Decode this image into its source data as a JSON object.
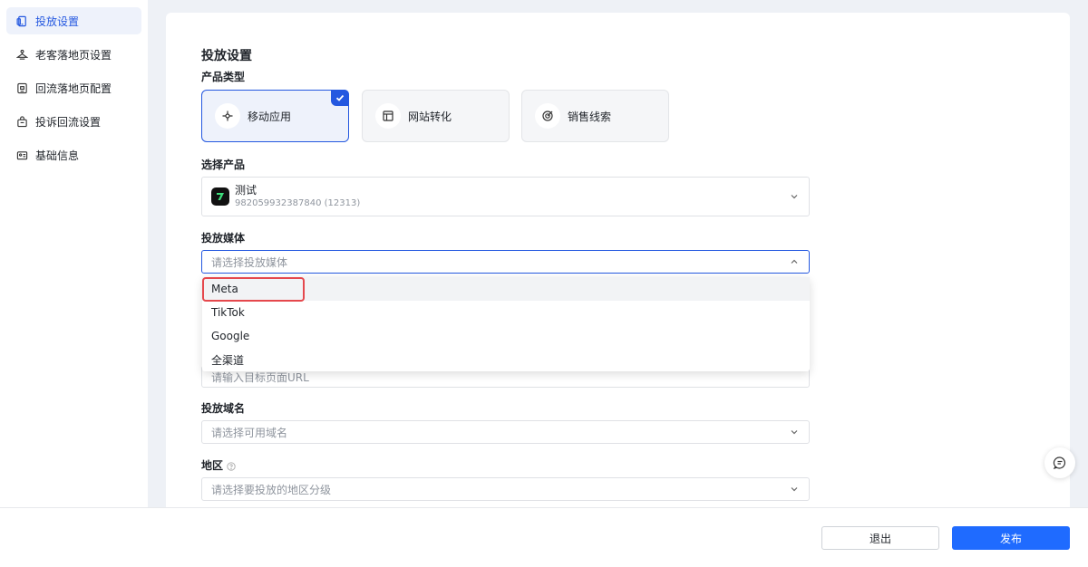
{
  "sidebar": {
    "items": [
      {
        "label": "投放设置",
        "icon": "device-icon",
        "active": true
      },
      {
        "label": "老客落地页设置",
        "icon": "hanger-icon"
      },
      {
        "label": "回流落地页配置",
        "icon": "page-icon"
      },
      {
        "label": "投诉回流设置",
        "icon": "bag-icon"
      },
      {
        "label": "基础信息",
        "icon": "id-card-icon"
      }
    ]
  },
  "main": {
    "section_title": "投放设置",
    "product_type": {
      "label": "产品类型",
      "options": [
        {
          "label": "移动应用",
          "icon": "joystick-icon",
          "selected": true
        },
        {
          "label": "网站转化",
          "icon": "layout-icon",
          "selected": false
        },
        {
          "label": "销售线索",
          "icon": "target-icon",
          "selected": false
        }
      ]
    },
    "select_product": {
      "label": "选择产品",
      "name": "测试",
      "id_text": "982059932387840 (12313)"
    },
    "media": {
      "label": "投放媒体",
      "placeholder": "请选择投放媒体",
      "options": [
        "Meta",
        "TikTok",
        "Google",
        "全渠道"
      ],
      "hovered": "Meta"
    },
    "url": {
      "placeholder": "请输入目标页面URL"
    },
    "domain": {
      "label": "投放域名",
      "placeholder": "请选择可用域名"
    },
    "region": {
      "label": "地区",
      "placeholder": "请选择要投放的地区分级"
    }
  },
  "footer": {
    "exit_label": "退出",
    "publish_label": "发布"
  },
  "colors": {
    "accent": "#2458e0",
    "publish": "#1f6bff",
    "highlight": "#e5484d"
  }
}
